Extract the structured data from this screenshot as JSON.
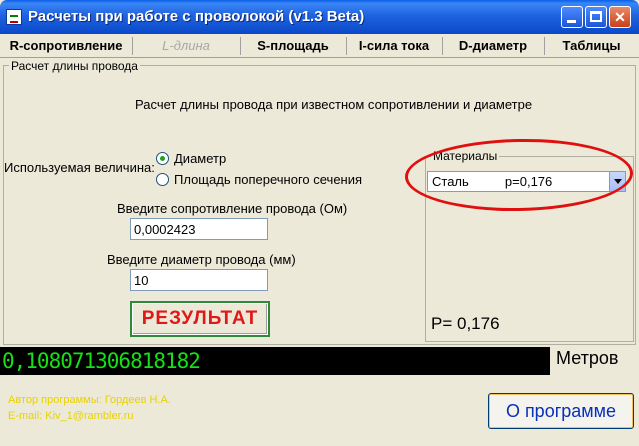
{
  "window": {
    "title": "Расчеты при работе с проволокой (v1.3 Beta)",
    "minimize": "",
    "maximize": "",
    "close": "✕"
  },
  "tabs": [
    {
      "label": "R-сопротивление",
      "enabled": true
    },
    {
      "label": "L-длина",
      "enabled": false
    },
    {
      "label": "S-площадь",
      "enabled": true
    },
    {
      "label": "I-сила тока",
      "enabled": true
    },
    {
      "label": "D-диаметр",
      "enabled": true
    },
    {
      "label": "Таблицы",
      "enabled": true
    }
  ],
  "main": {
    "group_title": "Расчет длины провода",
    "description": "Расчет длины провода при известном сопротивлении и диаметре",
    "quantity_label": "Используемая величина:",
    "options": [
      {
        "label": "Диаметр",
        "checked": true
      },
      {
        "label": "Площадь поперечного сечения",
        "checked": false
      }
    ],
    "resistance_label": "Введите сопротивление провода (Ом)",
    "resistance_value": "0,0002423",
    "diameter_label": "Введите диаметр провода (мм)",
    "diameter_value": "10",
    "result_button": "РЕЗУЛЬТАТ"
  },
  "materials": {
    "group_title": "Материалы",
    "selected": "Сталь          p=0,176",
    "rho_display": "P= 0,176",
    "highlight_color": "#e01010"
  },
  "output": {
    "value": "0,108071306818182",
    "unit": "Метров",
    "value_color": "#16e016"
  },
  "footer": {
    "credits_line1": "Автор программы: Гордеев Н.А.",
    "credits_line2": "E-mail: Kiv_1@rambler.ru",
    "about_button": "О программе"
  }
}
